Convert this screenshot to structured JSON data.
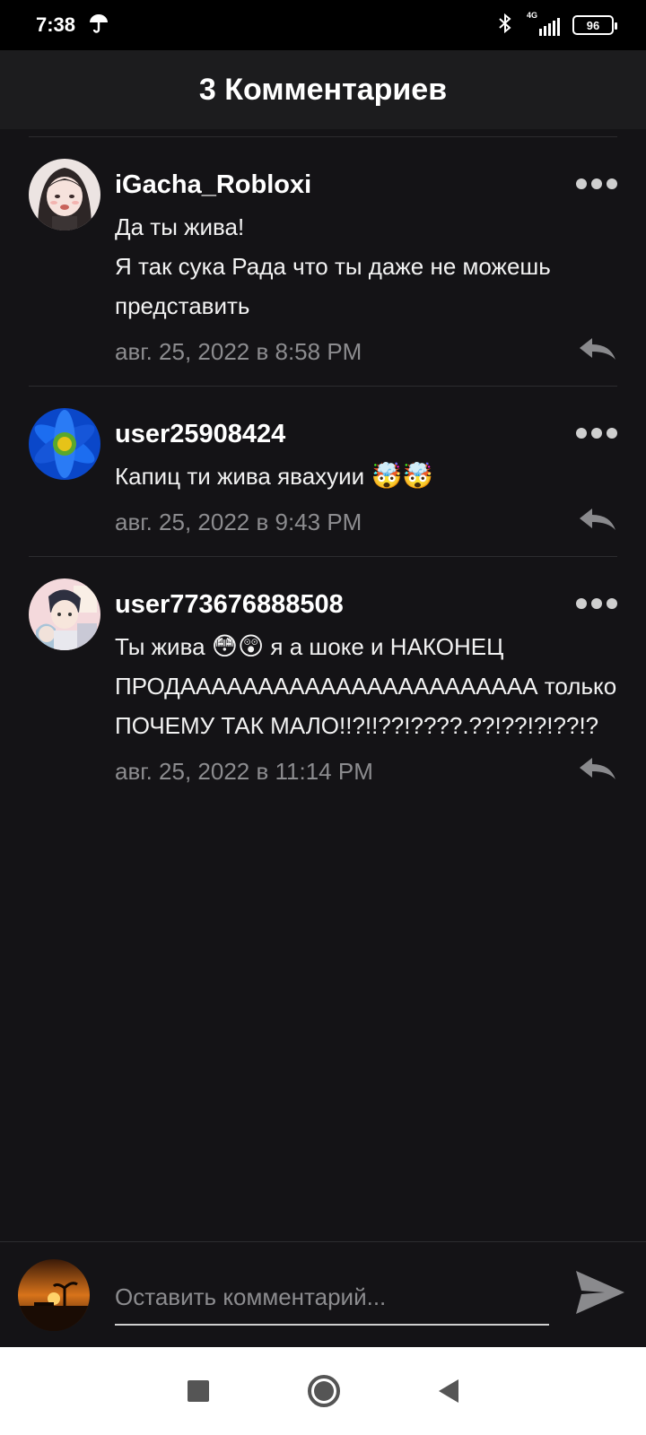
{
  "status_bar": {
    "time": "7:38",
    "network": "4G",
    "battery": "96"
  },
  "header": {
    "title": "3 Комментариев"
  },
  "comments": [
    {
      "username": "iGacha_Robloxi",
      "text": "Да  ты жива!\nЯ так сука Рада что ты даже не можешь представить",
      "date": "авг. 25, 2022 в 8:58 PM",
      "avatar": "anime-girl-avatar"
    },
    {
      "username": "user25908424",
      "text": "Капиц ти жива явахуии",
      "emoji": "🤯🤯",
      "date": "авг. 25, 2022 в 9:43 PM",
      "avatar": "blue-flower-avatar"
    },
    {
      "username": "user773676888508",
      "text_before_emoji": "Ты жива ",
      "emoji": "😳😲",
      "text_after_emoji": " я а шоке и НАКОНЕЦ ПРОДААААААААААААААААААААААА только ПОЧЕМУ ТАК МАЛО!!?!!??!????.??!??!?!??!?",
      "date": "авг. 25, 2022 в 11:14 PM",
      "avatar": "anime-boys-avatar"
    }
  ],
  "composer": {
    "placeholder": "Оставить комментарий..."
  },
  "colors": {
    "background": "#141316",
    "header_bg": "#1c1c1e",
    "meta_text": "#8c8c8f"
  }
}
